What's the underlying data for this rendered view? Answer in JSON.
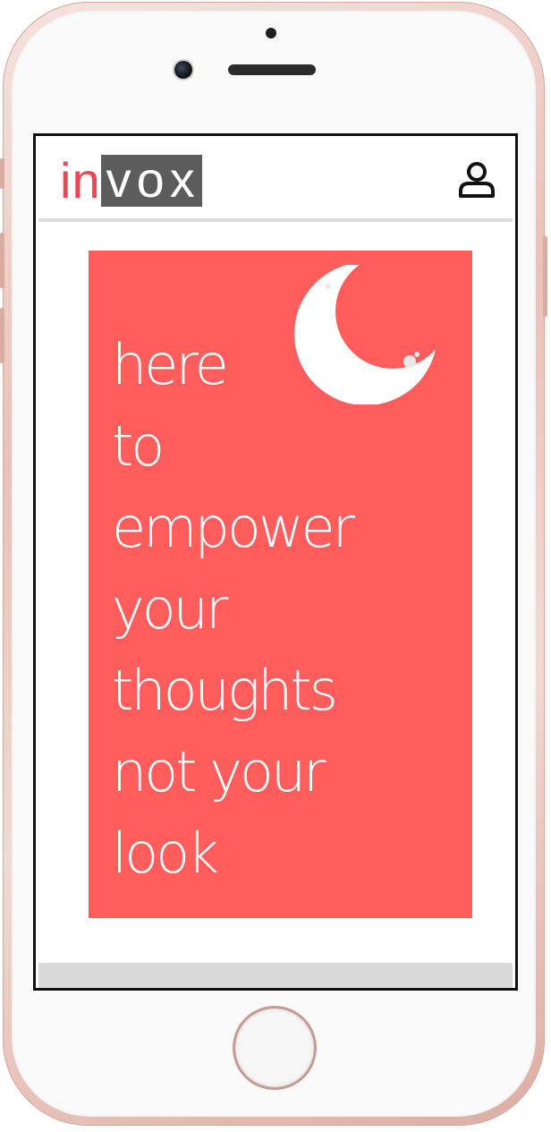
{
  "app": {
    "logo_prefix": "in",
    "logo_suffix": "vox"
  },
  "header": {
    "profile_icon": "user-icon"
  },
  "hero": {
    "lines": [
      "here",
      "to",
      "empower",
      "your",
      "thoughts",
      "not your",
      "look"
    ],
    "background_color": "#ff5c5c",
    "moon_icon": "crescent-moon-icon"
  },
  "colors": {
    "brand_red": "#ee4655",
    "logo_box": "#5c5c5c"
  }
}
